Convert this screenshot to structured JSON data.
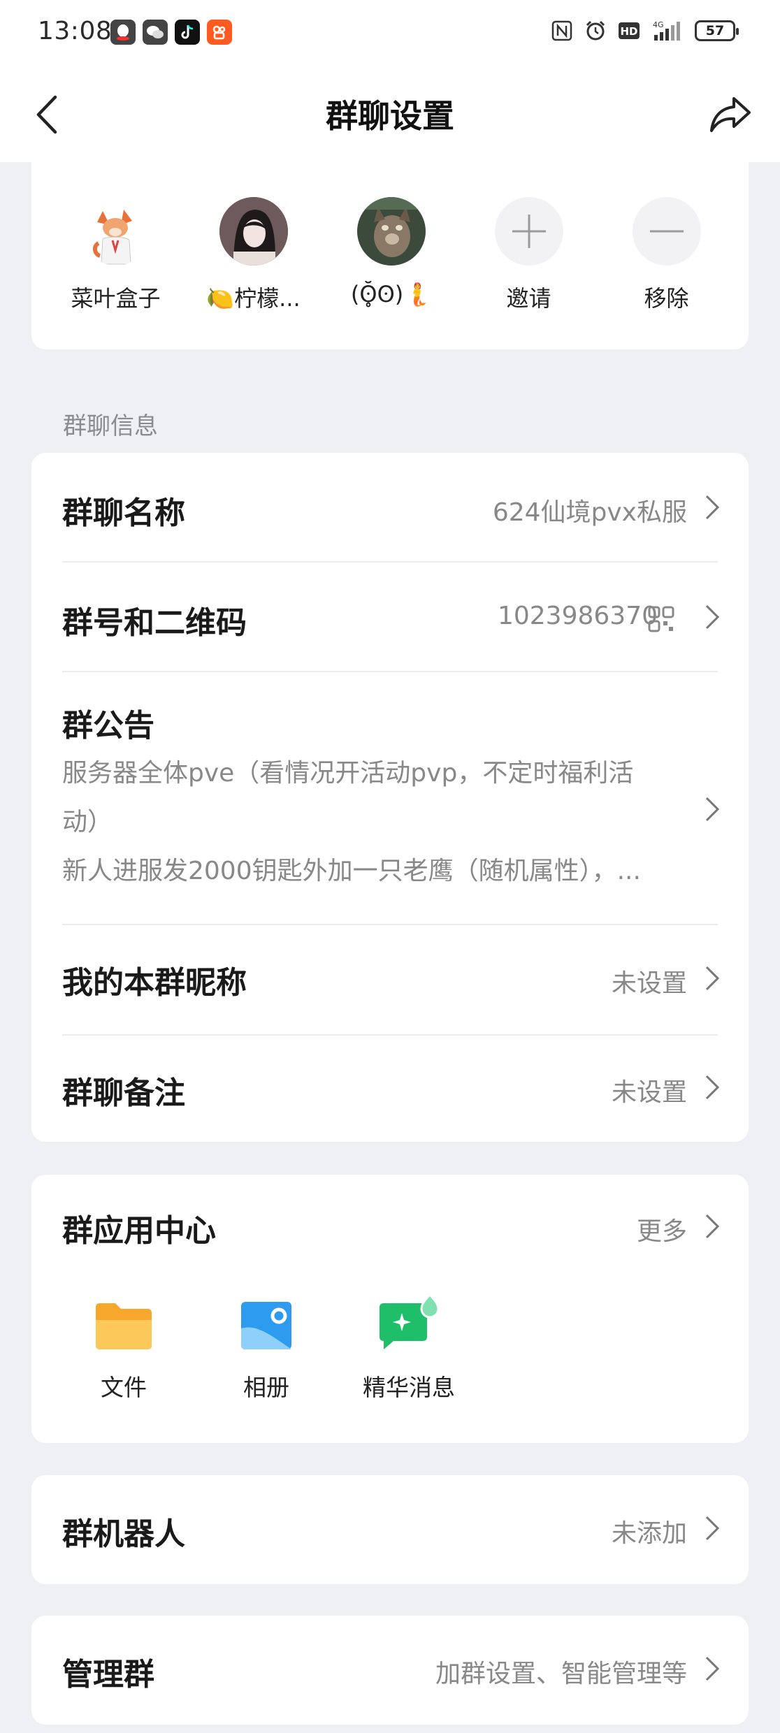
{
  "status_bar": {
    "time": "13:08",
    "network": "4G",
    "hd": "HD",
    "nfc": "N",
    "battery": "57"
  },
  "header": {
    "title": "群聊设置"
  },
  "members": [
    {
      "name": "菜叶盒子"
    },
    {
      "name": "🍋柠檬..."
    },
    {
      "name": "(ʘ̥̆ʘ)🧜"
    }
  ],
  "member_actions": {
    "invite_label": "邀请",
    "remove_label": "移除"
  },
  "info_section": {
    "title": "群聊信息",
    "name_label": "群聊名称",
    "name_value": "624仙境pvx私服",
    "number_label": "群号和二维码",
    "number_value": "1023986370",
    "notice_label": "群公告",
    "notice_line1": "服务器全体pve（看情况开活动pvp，不定时福利活",
    "notice_line2": "动）",
    "notice_line3": "新人进服发2000钥匙外加一只老鹰（随机属性），...",
    "nickname_label": "我的本群昵称",
    "nickname_value": "未设置",
    "remark_label": "群聊备注",
    "remark_value": "未设置"
  },
  "apps_section": {
    "title": "群应用中心",
    "more_label": "更多",
    "apps": [
      {
        "label": "文件",
        "icon": "folder-icon"
      },
      {
        "label": "相册",
        "icon": "album-icon"
      },
      {
        "label": "精华消息",
        "icon": "essence-message-icon"
      }
    ]
  },
  "bot_section": {
    "label": "群机器人",
    "value": "未添加"
  },
  "manage_section": {
    "label": "管理群",
    "value": "加群设置、智能管理等"
  },
  "colors": {
    "background": "#eff0f4",
    "card": "#ffffff",
    "secondary_text": "#888888",
    "folder": "#f9b83c",
    "album": "#2d9cf0",
    "essence": "#1fbf6a"
  }
}
